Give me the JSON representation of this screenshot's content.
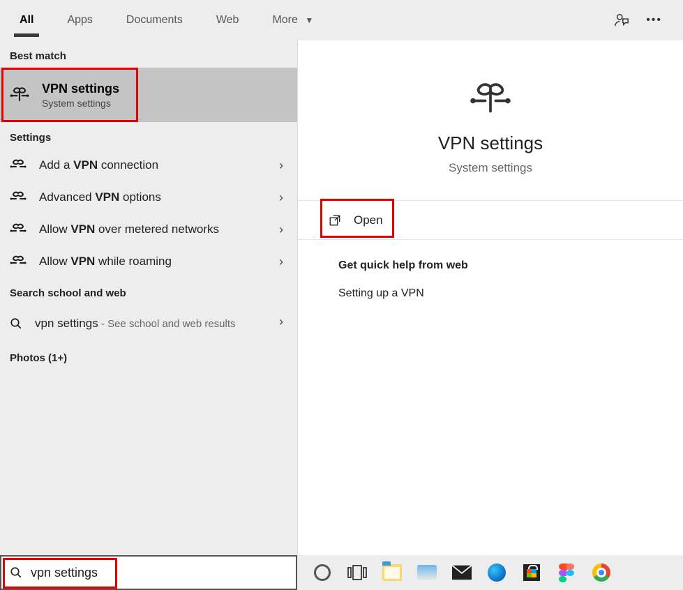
{
  "tabs": {
    "all": "All",
    "apps": "Apps",
    "documents": "Documents",
    "web": "Web",
    "more": "More"
  },
  "sections": {
    "best_match": "Best match",
    "settings": "Settings",
    "search_sw": "Search school and web",
    "photos": "Photos (1+)"
  },
  "best_match": {
    "title": "VPN settings",
    "subtitle": "System settings"
  },
  "settings_items": {
    "add_pre": "Add a ",
    "add_b": "VPN",
    "add_post": " connection",
    "adv_pre": "Advanced ",
    "adv_b": "VPN",
    "adv_post": " options",
    "met_pre": "Allow ",
    "met_b": "VPN",
    "met_post": " over metered networks",
    "roam_pre": "Allow ",
    "roam_b": "VPN",
    "roam_post": " while roaming"
  },
  "web_item": {
    "q": "vpn settings",
    "note": " - See school and web results"
  },
  "preview": {
    "title": "VPN settings",
    "subtitle": "System settings",
    "open": "Open"
  },
  "webhelp": {
    "header": "Get quick help from web",
    "link1": "Setting up a VPN"
  },
  "search": {
    "value": "vpn settings"
  }
}
